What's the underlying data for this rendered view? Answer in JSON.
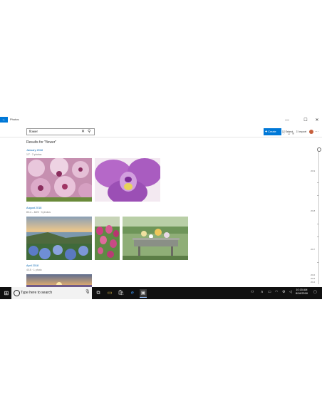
{
  "window": {
    "app_title": "Photos",
    "back_symbol": "←",
    "minimize_symbol": "—",
    "maximize_symbol": "☐",
    "close_symbol": "✕"
  },
  "toolbar": {
    "search_value": "flower",
    "clear_symbol": "✕",
    "search_symbol": "⚲",
    "create_label": "Create",
    "select_label": "Select",
    "import_label": "Import",
    "more_symbol": "···"
  },
  "results": {
    "heading": "Results for \"flower\""
  },
  "groups": [
    {
      "title": "January 2018",
      "meta": "1/7 · 2 photos"
    },
    {
      "title": "August 2018",
      "meta": "8/14 – 8/25 · 3 photos"
    },
    {
      "title": "April 2018",
      "meta": "4/15 · 1 photo"
    }
  ],
  "timeline": {
    "labels": [
      "2019",
      "2018",
      "2017",
      "2016",
      "2015",
      "2014"
    ]
  },
  "taskbar": {
    "search_placeholder": "Type here to search",
    "time": "10:15 AM",
    "date": "8/16/2018"
  }
}
